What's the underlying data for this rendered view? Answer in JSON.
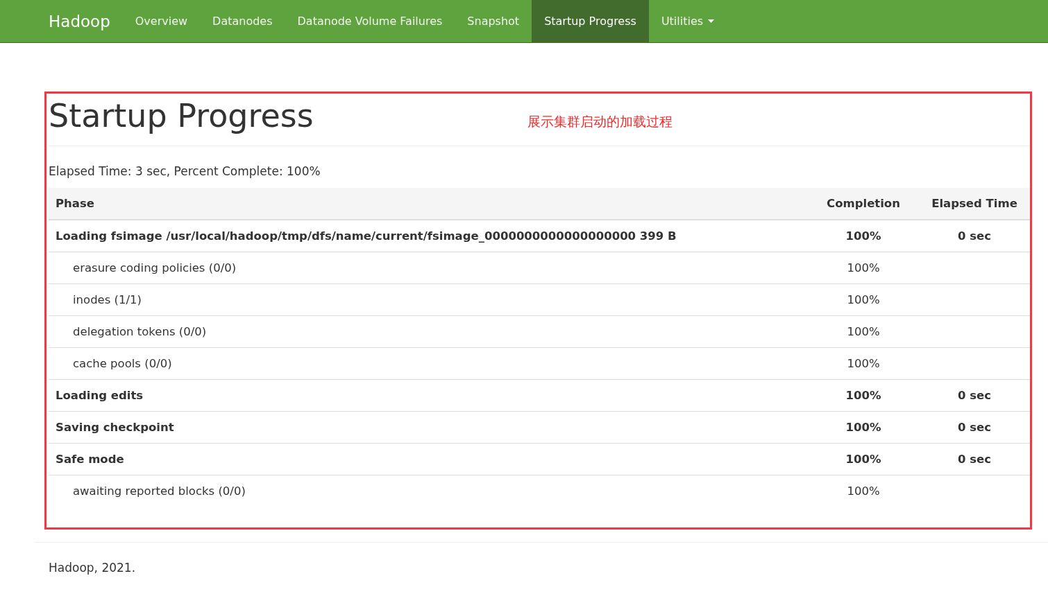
{
  "navbar": {
    "brand": "Hadoop",
    "items": [
      {
        "label": "Overview",
        "selected": false,
        "dropdown": false
      },
      {
        "label": "Datanodes",
        "selected": false,
        "dropdown": false
      },
      {
        "label": "Datanode Volume Failures",
        "selected": false,
        "dropdown": false
      },
      {
        "label": "Snapshot",
        "selected": false,
        "dropdown": false
      },
      {
        "label": "Startup Progress",
        "selected": true,
        "dropdown": false
      },
      {
        "label": "Utilities",
        "selected": false,
        "dropdown": true
      }
    ]
  },
  "page": {
    "title": "Startup Progress",
    "annotation": "展示集群启动的加载过程",
    "summary": "Elapsed Time: 3 sec, Percent Complete: 100%"
  },
  "table": {
    "columns": [
      "Phase",
      "Completion",
      "Elapsed Time"
    ],
    "rows": [
      {
        "kind": "phase",
        "name": "Loading fsimage /usr/local/hadoop/tmp/dfs/name/current/fsimage_0000000000000000000 399 B",
        "completion": "100%",
        "elapsed": "0 sec"
      },
      {
        "kind": "step",
        "name": "erasure coding policies (0/0)",
        "completion": "100%"
      },
      {
        "kind": "step",
        "name": "inodes (1/1)",
        "completion": "100%"
      },
      {
        "kind": "step",
        "name": "delegation tokens (0/0)",
        "completion": "100%"
      },
      {
        "kind": "step",
        "name": "cache pools (0/0)",
        "completion": "100%"
      },
      {
        "kind": "phase",
        "name": "Loading edits",
        "completion": "100%",
        "elapsed": "0 sec"
      },
      {
        "kind": "phase",
        "name": "Saving checkpoint",
        "completion": "100%",
        "elapsed": "0 sec"
      },
      {
        "kind": "phase",
        "name": "Safe mode",
        "completion": "100%",
        "elapsed": "0 sec"
      },
      {
        "kind": "step",
        "name": "awaiting reported blocks (0/0)",
        "completion": "100%"
      }
    ]
  },
  "footer": "Hadoop, 2021."
}
